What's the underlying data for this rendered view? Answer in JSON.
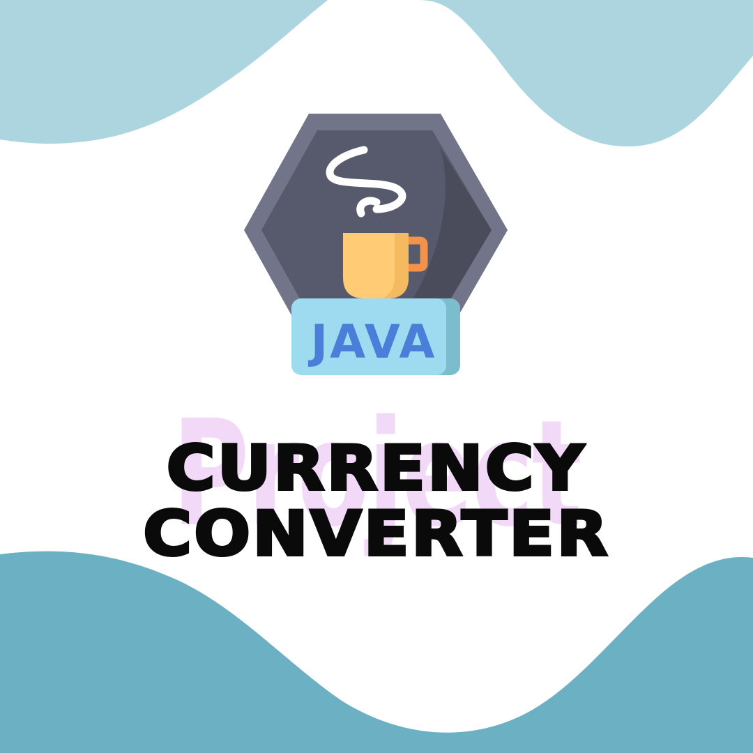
{
  "logo": {
    "badge_text": "JAVA",
    "icon": "java-coffee-cup-icon"
  },
  "watermark_text": "Project",
  "title_line1": "CURRENCY",
  "title_line2": "CONVERTER",
  "colors": {
    "wave_top": "#add5df",
    "wave_bottom": "#6cb0c3",
    "hexagon_outer": "#72758a",
    "hexagon_inner": "#575a6d",
    "hexagon_shadow": "#4a4c5c",
    "cup": "#ffcb75",
    "cup_handle": "#f5924a",
    "badge_face": "#9fdbf0",
    "badge_side": "#7bbdcc",
    "badge_text": "#4a7fd9",
    "watermark": "#f1d9f7",
    "title": "#0a0a0a"
  }
}
